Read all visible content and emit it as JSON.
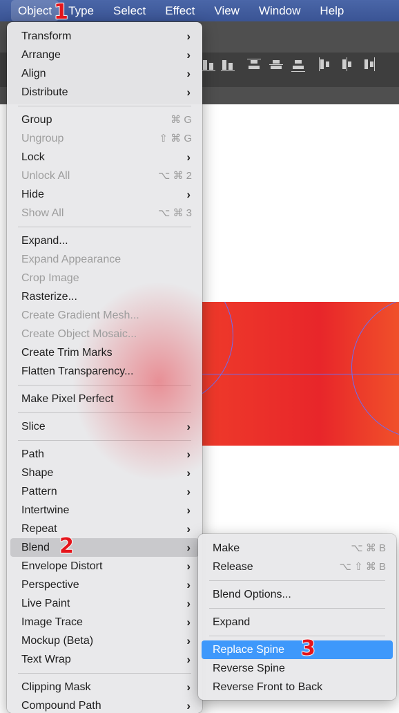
{
  "menubar": [
    "Object",
    "Type",
    "Select",
    "Effect",
    "View",
    "Window",
    "Help"
  ],
  "object_menu": [
    {
      "label": "Transform",
      "submenu": true
    },
    {
      "label": "Arrange",
      "submenu": true
    },
    {
      "label": "Align",
      "submenu": true
    },
    {
      "label": "Distribute",
      "submenu": true
    },
    {
      "sep": true
    },
    {
      "label": "Group",
      "shortcut": "⌘ G"
    },
    {
      "label": "Ungroup",
      "shortcut": "⇧ ⌘ G",
      "disabled": true
    },
    {
      "label": "Lock",
      "submenu": true
    },
    {
      "label": "Unlock All",
      "shortcut": "⌥ ⌘ 2",
      "disabled": true
    },
    {
      "label": "Hide",
      "submenu": true
    },
    {
      "label": "Show All",
      "shortcut": "⌥ ⌘ 3",
      "disabled": true
    },
    {
      "sep": true
    },
    {
      "label": "Expand..."
    },
    {
      "label": "Expand Appearance",
      "disabled": true
    },
    {
      "label": "Crop Image",
      "disabled": true
    },
    {
      "label": "Rasterize..."
    },
    {
      "label": "Create Gradient Mesh...",
      "disabled": true
    },
    {
      "label": "Create Object Mosaic...",
      "disabled": true
    },
    {
      "label": "Create Trim Marks"
    },
    {
      "label": "Flatten Transparency..."
    },
    {
      "sep": true
    },
    {
      "label": "Make Pixel Perfect"
    },
    {
      "sep": true
    },
    {
      "label": "Slice",
      "submenu": true
    },
    {
      "sep": true
    },
    {
      "label": "Path",
      "submenu": true
    },
    {
      "label": "Shape",
      "submenu": true
    },
    {
      "label": "Pattern",
      "submenu": true
    },
    {
      "label": "Intertwine",
      "submenu": true
    },
    {
      "label": "Repeat",
      "submenu": true
    },
    {
      "label": "Blend",
      "submenu": true,
      "highlighted": true
    },
    {
      "label": "Envelope Distort",
      "submenu": true
    },
    {
      "label": "Perspective",
      "submenu": true
    },
    {
      "label": "Live Paint",
      "submenu": true
    },
    {
      "label": "Image Trace",
      "submenu": true
    },
    {
      "label": "Mockup (Beta)",
      "submenu": true
    },
    {
      "label": "Text Wrap",
      "submenu": true
    },
    {
      "sep": true
    },
    {
      "label": "Clipping Mask",
      "submenu": true
    },
    {
      "label": "Compound Path",
      "submenu": true
    }
  ],
  "blend_menu": [
    {
      "label": "Make",
      "shortcut": "⌥ ⌘ B"
    },
    {
      "label": "Release",
      "shortcut": "⌥ ⇧ ⌘ B"
    },
    {
      "sep": true
    },
    {
      "label": "Blend Options..."
    },
    {
      "sep": true
    },
    {
      "label": "Expand"
    },
    {
      "sep": true
    },
    {
      "label": "Replace Spine",
      "selected": true
    },
    {
      "label": "Reverse Spine"
    },
    {
      "label": "Reverse Front to Back"
    }
  ],
  "annotations": [
    "1",
    "2",
    "3"
  ],
  "colors": {
    "menubar": "#3f5a9c",
    "selection": "#3e98fb",
    "artwork": "#e8262a",
    "annotation": "#e4141b"
  }
}
